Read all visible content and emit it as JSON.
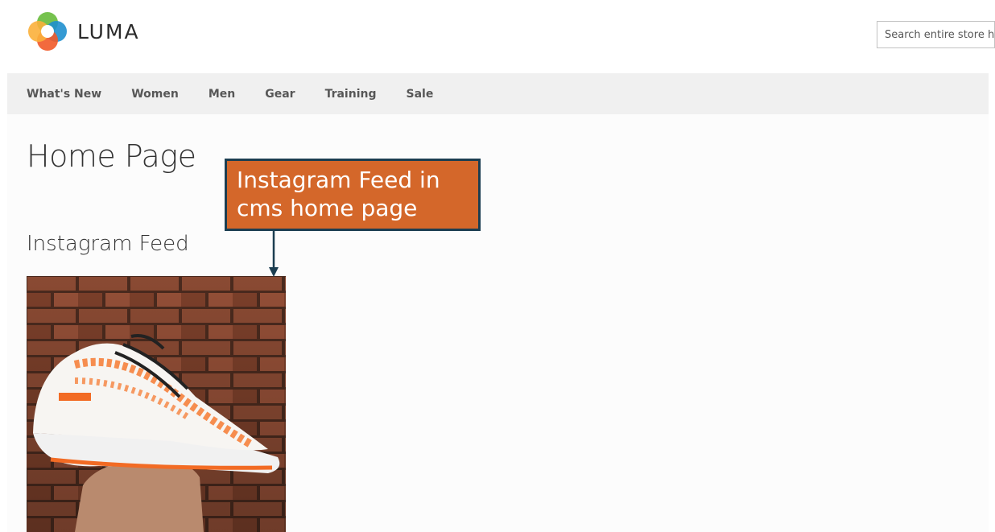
{
  "header": {
    "logo_text": "LUMA",
    "search_placeholder": "Search entire store here..."
  },
  "nav": {
    "items": [
      "What's New",
      "Women",
      "Men",
      "Gear",
      "Training",
      "Sale"
    ]
  },
  "main": {
    "page_title": "Home Page",
    "section_title": "Instagram Feed"
  },
  "annotation": {
    "line1": "Instagram Feed in",
    "line2": "cms home page"
  },
  "colors": {
    "nav_bg": "#f0f0f0",
    "callout_bg": "#d4672a",
    "callout_border": "#1c3e51"
  },
  "icons": {
    "logo": "luma-logo-icon"
  }
}
